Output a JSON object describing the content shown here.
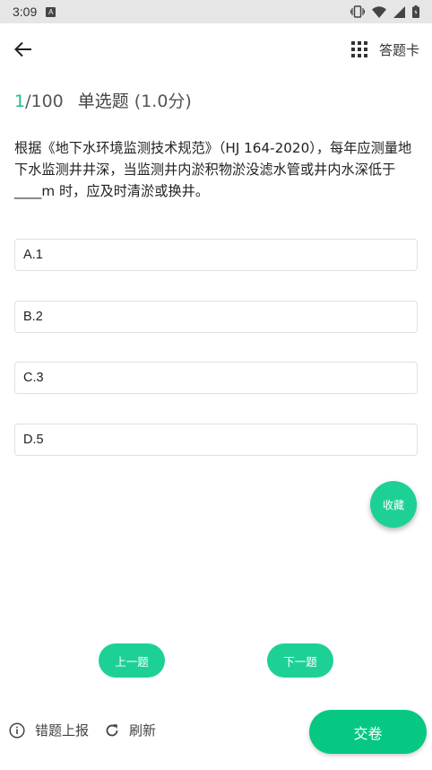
{
  "status_bar": {
    "time": "3:09",
    "notification_badge": "A"
  },
  "header": {
    "answer_card_label": "答题卡"
  },
  "question": {
    "current": "1",
    "total": "/100",
    "type": "单选题",
    "score": "(1.0分)",
    "text": "根据《地下水环境监测技术规范》（HJ 164-2020），每年应测量地下水监测井井深，当监测井内淤积物淤没滤水管或井内水深低于____m 时，应及时清淤或换井。",
    "options": [
      "A.1",
      "B.2",
      "C.3",
      "D.5"
    ]
  },
  "actions": {
    "favorite_label": "收藏",
    "prev_label": "上一题",
    "next_label": "下一题",
    "report_label": "错题上报",
    "refresh_label": "刷新",
    "submit_label": "交卷"
  },
  "colors": {
    "accent": "#1dd196",
    "accent_dark": "#06c882",
    "progress_text": "#1dbf83",
    "status_bar_bg": "#e6e6e6"
  }
}
